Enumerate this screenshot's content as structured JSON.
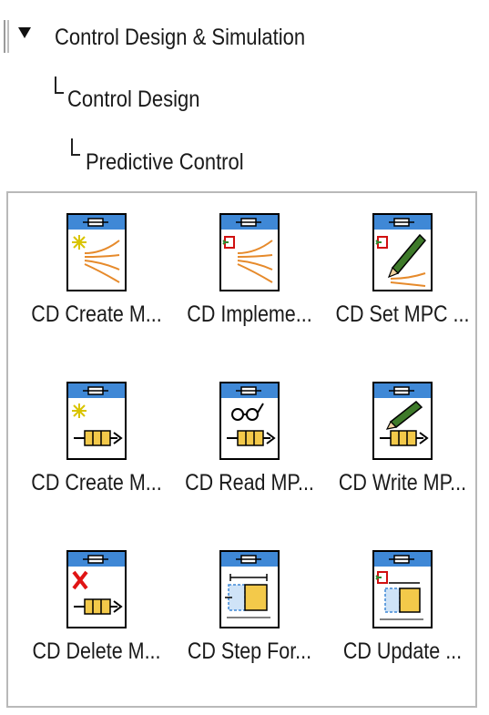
{
  "breadcrumb": {
    "level1": "Control Design & Simulation",
    "level2": "Control Design",
    "level3": "Predictive Control"
  },
  "palette": {
    "items": [
      {
        "label": "CD Create M...",
        "icon": "create-model-icon"
      },
      {
        "label": "CD Impleme...",
        "icon": "implement-controller-icon"
      },
      {
        "label": "CD Set MPC ...",
        "icon": "set-mpc-icon"
      },
      {
        "label": "CD Create M...",
        "icon": "create-controller-icon"
      },
      {
        "label": "CD Read MP...",
        "icon": "read-mpc-icon"
      },
      {
        "label": "CD Write MP...",
        "icon": "write-mpc-icon"
      },
      {
        "label": "CD Delete M...",
        "icon": "delete-mpc-icon"
      },
      {
        "label": "CD Step For...",
        "icon": "step-forward-icon"
      },
      {
        "label": "CD Update ...",
        "icon": "update-window-icon"
      }
    ]
  },
  "colors": {
    "icon_header": "#3f88d6",
    "accent_orange": "#e68a2b",
    "pencil_green": "#3e7a2a",
    "delete_red": "#e01414",
    "window_yellow": "#f3c94a"
  }
}
